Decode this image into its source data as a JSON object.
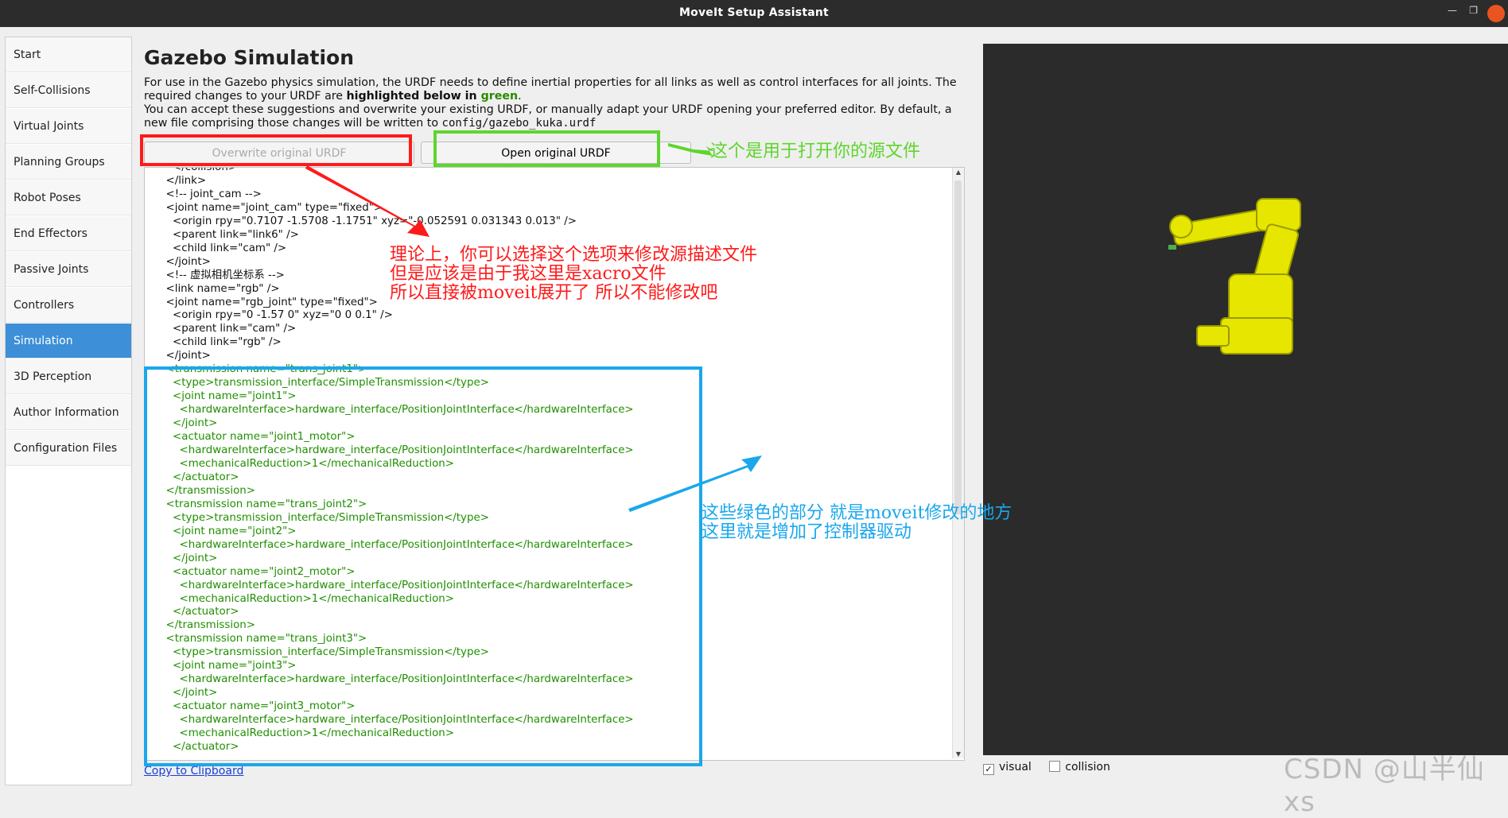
{
  "window": {
    "title": "MoveIt Setup Assistant"
  },
  "sidebar": {
    "items": [
      {
        "label": "Start"
      },
      {
        "label": "Self-Collisions"
      },
      {
        "label": "Virtual Joints"
      },
      {
        "label": "Planning Groups"
      },
      {
        "label": "Robot Poses"
      },
      {
        "label": "End Effectors"
      },
      {
        "label": "Passive Joints"
      },
      {
        "label": "Controllers"
      },
      {
        "label": "Simulation"
      },
      {
        "label": "3D Perception"
      },
      {
        "label": "Author Information"
      },
      {
        "label": "Configuration Files"
      }
    ],
    "active_index": 8
  },
  "page": {
    "title": "Gazebo Simulation",
    "desc1": "For use in the Gazebo physics simulation, the URDF needs to define inertial properties for all links as well as control interfaces for all joints. The required changes to your URDF are ",
    "desc_bold": "highlighted below in ",
    "desc_green": "green",
    "desc2": "You can accept these suggestions and overwrite your existing URDF, or manually adapt your URDF opening your preferred editor. By default, a new file comprising those changes will be written to ",
    "desc_path": "config/gazebo_kuka.urdf"
  },
  "buttons": {
    "overwrite": "Overwrite original URDF",
    "open": "Open original URDF"
  },
  "code": {
    "plain": [
      "    </collision>",
      "  </link>",
      "  <!-- joint_cam -->",
      "  <joint name=\"joint_cam\" type=\"fixed\">",
      "    <origin rpy=\"0.7107 -1.5708 -1.1751\" xyz=\"-0.052591 0.031343 0.013\" />",
      "    <parent link=\"link6\" />",
      "    <child link=\"cam\" />",
      "  </joint>",
      "  <!-- 虚拟相机坐标系 -->",
      "  <link name=\"rgb\" />",
      "  <joint name=\"rgb_joint\" type=\"fixed\">",
      "    <origin rpy=\"0 -1.57 0\" xyz=\"0 0 0.1\" />",
      "    <parent link=\"cam\" />",
      "    <child link=\"rgb\" />",
      "  </joint>"
    ],
    "green": [
      "  <transmission name=\"trans_joint1\">",
      "    <type>transmission_interface/SimpleTransmission</type>",
      "    <joint name=\"joint1\">",
      "      <hardwareInterface>hardware_interface/PositionJointInterface</hardwareInterface>",
      "    </joint>",
      "    <actuator name=\"joint1_motor\">",
      "      <hardwareInterface>hardware_interface/PositionJointInterface</hardwareInterface>",
      "      <mechanicalReduction>1</mechanicalReduction>",
      "    </actuator>",
      "  </transmission>",
      "  <transmission name=\"trans_joint2\">",
      "    <type>transmission_interface/SimpleTransmission</type>",
      "    <joint name=\"joint2\">",
      "      <hardwareInterface>hardware_interface/PositionJointInterface</hardwareInterface>",
      "    </joint>",
      "    <actuator name=\"joint2_motor\">",
      "      <hardwareInterface>hardware_interface/PositionJointInterface</hardwareInterface>",
      "      <mechanicalReduction>1</mechanicalReduction>",
      "    </actuator>",
      "  </transmission>",
      "  <transmission name=\"trans_joint3\">",
      "    <type>transmission_interface/SimpleTransmission</type>",
      "    <joint name=\"joint3\">",
      "      <hardwareInterface>hardware_interface/PositionJointInterface</hardwareInterface>",
      "    </joint>",
      "    <actuator name=\"joint3_motor\">",
      "      <hardwareInterface>hardware_interface/PositionJointInterface</hardwareInterface>",
      "      <mechanicalReduction>1</mechanicalReduction>",
      "    </actuator>"
    ]
  },
  "copy_link": "Copy to Clipboard",
  "viewer": {
    "visual_label": "visual",
    "visual_checked": true,
    "collision_label": "collision",
    "collision_checked": false
  },
  "annotations": {
    "open_note": "这个是用于打开你的源文件",
    "red_note": [
      "理论上，你可以选择这个选项来修改源描述文件",
      "但是应该是由于我这里是xacro文件",
      "所以直接被moveit展开了 所以不能修改吧"
    ],
    "blue_note": [
      "这些绿色的部分 就是moveit修改的地方",
      "这里就是增加了控制器驱动"
    ]
  },
  "watermark": "CSDN @山半仙xs",
  "colors": {
    "accent": "#3d8fd8",
    "green_text": "#1f8f00",
    "annotation_red": "#ff1a1a",
    "annotation_green": "#5dd62c",
    "annotation_blue": "#1aa7ec",
    "robot": "#e6e600"
  }
}
